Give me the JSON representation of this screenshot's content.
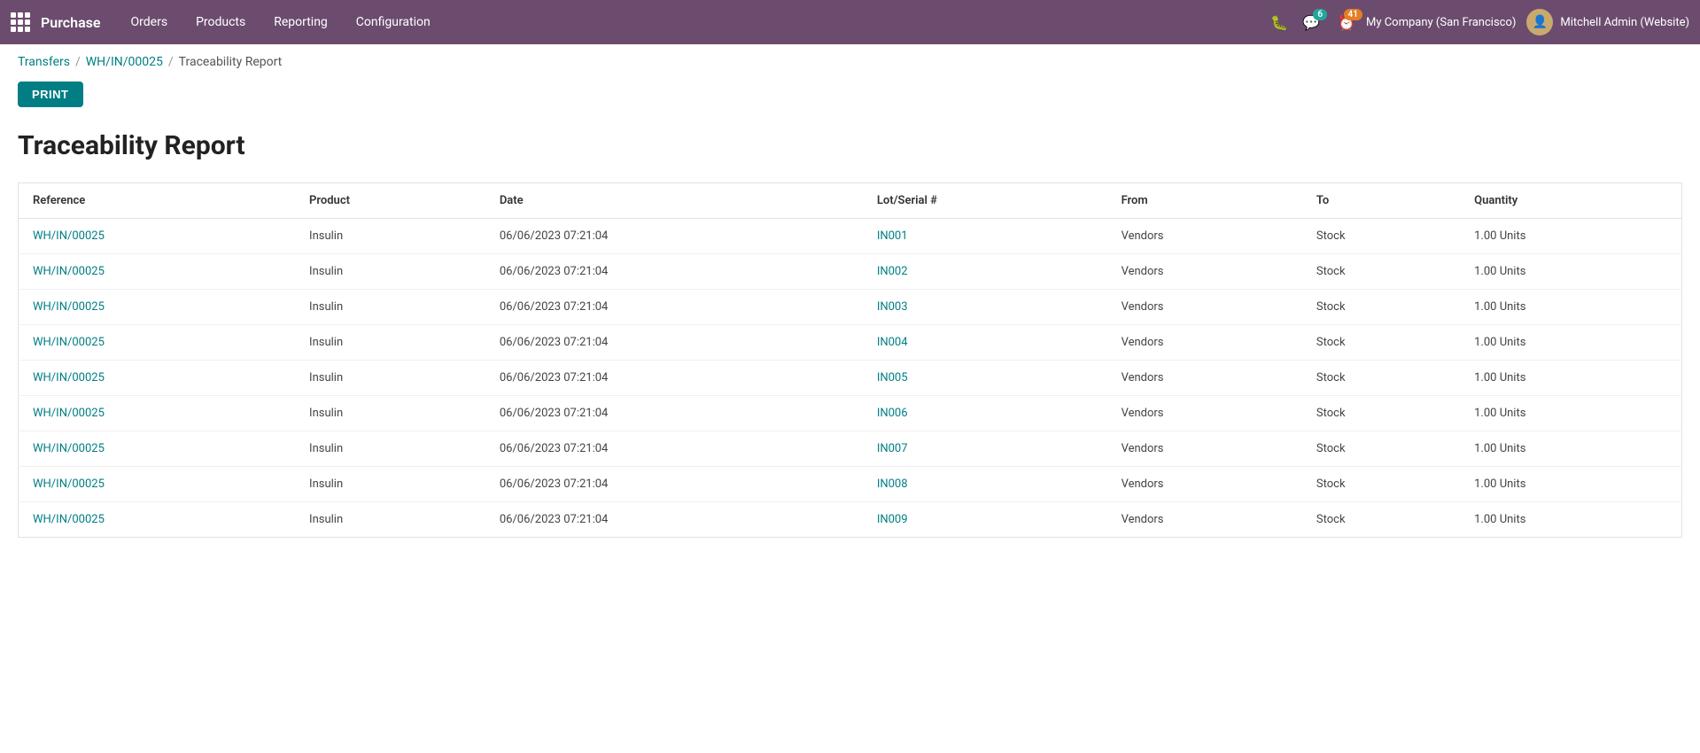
{
  "topnav": {
    "brand": "Purchase",
    "menu_items": [
      "Orders",
      "Products",
      "Reporting",
      "Configuration"
    ],
    "chat_badge": "6",
    "activity_badge": "41",
    "company": "My Company (San Francisco)",
    "user": "Mitchell Admin (Website)"
  },
  "breadcrumb": {
    "transfers_label": "Transfers",
    "transfer_id": "WH/IN/00025",
    "current_page": "Traceability Report"
  },
  "action_bar": {
    "print_label": "PRINT"
  },
  "report": {
    "title": "Traceability Report",
    "columns": [
      "Reference",
      "Product",
      "Date",
      "Lot/Serial #",
      "From",
      "To",
      "Quantity"
    ],
    "rows": [
      {
        "reference": "WH/IN/00025",
        "product": "Insulin",
        "date": "06/06/2023 07:21:04",
        "lot": "IN001",
        "from": "Vendors",
        "to": "Stock",
        "quantity": "1.00 Units"
      },
      {
        "reference": "WH/IN/00025",
        "product": "Insulin",
        "date": "06/06/2023 07:21:04",
        "lot": "IN002",
        "from": "Vendors",
        "to": "Stock",
        "quantity": "1.00 Units"
      },
      {
        "reference": "WH/IN/00025",
        "product": "Insulin",
        "date": "06/06/2023 07:21:04",
        "lot": "IN003",
        "from": "Vendors",
        "to": "Stock",
        "quantity": "1.00 Units"
      },
      {
        "reference": "WH/IN/00025",
        "product": "Insulin",
        "date": "06/06/2023 07:21:04",
        "lot": "IN004",
        "from": "Vendors",
        "to": "Stock",
        "quantity": "1.00 Units"
      },
      {
        "reference": "WH/IN/00025",
        "product": "Insulin",
        "date": "06/06/2023 07:21:04",
        "lot": "IN005",
        "from": "Vendors",
        "to": "Stock",
        "quantity": "1.00 Units"
      },
      {
        "reference": "WH/IN/00025",
        "product": "Insulin",
        "date": "06/06/2023 07:21:04",
        "lot": "IN006",
        "from": "Vendors",
        "to": "Stock",
        "quantity": "1.00 Units"
      },
      {
        "reference": "WH/IN/00025",
        "product": "Insulin",
        "date": "06/06/2023 07:21:04",
        "lot": "IN007",
        "from": "Vendors",
        "to": "Stock",
        "quantity": "1.00 Units"
      },
      {
        "reference": "WH/IN/00025",
        "product": "Insulin",
        "date": "06/06/2023 07:21:04",
        "lot": "IN008",
        "from": "Vendors",
        "to": "Stock",
        "quantity": "1.00 Units"
      },
      {
        "reference": "WH/IN/00025",
        "product": "Insulin",
        "date": "06/06/2023 07:21:04",
        "lot": "IN009",
        "from": "Vendors",
        "to": "Stock",
        "quantity": "1.00 Units"
      }
    ]
  }
}
